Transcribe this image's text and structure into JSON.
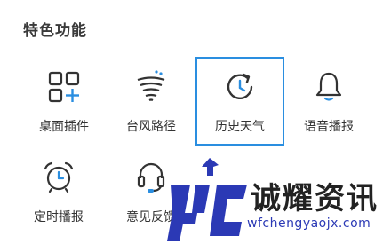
{
  "section": {
    "title": "特色功能"
  },
  "features": [
    {
      "label": "桌面插件",
      "icon": "widget-add-icon"
    },
    {
      "label": "台风路径",
      "icon": "typhoon-icon"
    },
    {
      "label": "历史天气",
      "icon": "history-icon",
      "selected": true
    },
    {
      "label": "语音播报",
      "icon": "bell-icon"
    },
    {
      "label": "定时播报",
      "icon": "alarm-clock-icon"
    },
    {
      "label": "意见反馈",
      "icon": "headset-icon"
    }
  ],
  "watermark": {
    "brand": "诚耀资讯",
    "url": "wfchengyaojx.com",
    "color": "#2b39b5"
  },
  "colors": {
    "selection": "#2a8ee0",
    "accent_blue": "#2a8ee0",
    "text": "#333333"
  }
}
